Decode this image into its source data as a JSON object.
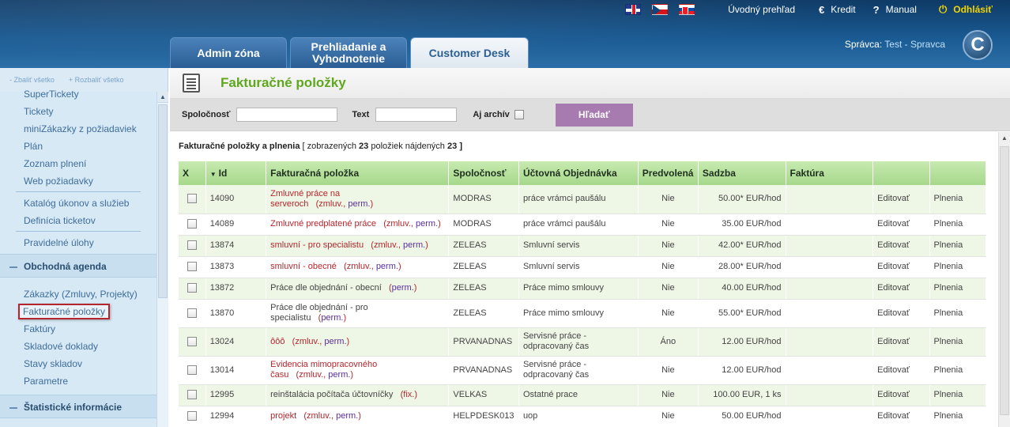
{
  "header": {
    "languages": [
      "English",
      "Czech",
      "Slovak"
    ],
    "links": {
      "overview": "Úvodný prehľad",
      "credit": "Kredit",
      "manual": "Manual",
      "logout": "Odhlásiť"
    },
    "tabs": [
      {
        "label_line1": "Admin zóna",
        "label_line2": ""
      },
      {
        "label_line1": "Prehliadanie a",
        "label_line2": "Vyhodnotenie"
      },
      {
        "label_line1": "Customer Desk",
        "label_line2": ""
      }
    ],
    "admin_prefix": "Správca:",
    "admin_name": "Test - Spravca",
    "logo_letter": "C"
  },
  "sidebar": {
    "collapse_all": "- Zbaliť všetko",
    "expand_all": "+ Rozbaliť všetko",
    "items_group1": [
      "SuperTickety",
      "Tickety",
      "miniZákazky z požiadaviek",
      "Plán",
      "Zoznam plnení",
      "Web požiadavky"
    ],
    "items_group2": [
      "Katalóg úkonov a služieb",
      "Definícia ticketov"
    ],
    "items_group3": [
      "Pravidelné úlohy"
    ],
    "section1": "Obchodná agenda",
    "items_group4": [
      "Zákazky (Zmluvy, Projekty)",
      "Fakturačné položky",
      "Faktúry",
      "Skladové doklady",
      "Stavy skladov",
      "Parametre"
    ],
    "section2": "Štatistické informácie"
  },
  "page": {
    "title": "Fakturačné položky",
    "filter": {
      "company_label": "Spoločnosť",
      "company_value": "",
      "text_label": "Text",
      "text_value": "",
      "archive_label": "Aj archív",
      "search_button": "Hľadať"
    },
    "summary": {
      "title": "Fakturačné položky a plnenia",
      "prefix": "[ zobrazených",
      "shown": "23",
      "middle": "položiek nájdených",
      "found": "23",
      "suffix": "]"
    },
    "table": {
      "columns": [
        "X",
        "Id",
        "Fakturačná položka",
        "Spoločnosť",
        "Účtovná Objednávka",
        "Predvolená",
        "Sadzba",
        "Faktúra",
        "",
        ""
      ],
      "rows": [
        {
          "id": "14090",
          "name_line1": "Zmluvné práce na",
          "name_line2": "serveroch",
          "tag": "(",
          "tag1": "zmluv.",
          "tag_sep": ", ",
          "tag2": "perm.",
          "tag_end": ")",
          "name_plain": false,
          "company": "MODRAS",
          "order_line1": "práce vrámci paušálu",
          "order_line2": "",
          "default": "Nie",
          "rate": "50.00* EUR/hod",
          "invoice": "",
          "edit": "Editovať",
          "fulfil": "Plnenia"
        },
        {
          "id": "14089",
          "name_line1": "Zmluvné predplatené práce",
          "name_line2": "",
          "tag": "(",
          "tag1": "zmluv.",
          "tag_sep": ", ",
          "tag2": "perm.",
          "tag_end": ")",
          "name_plain": false,
          "company": "MODRAS",
          "order_line1": "práce vrámci paušálu",
          "order_line2": "",
          "default": "Nie",
          "rate": "35.00 EUR/hod",
          "invoice": "",
          "edit": "Editovať",
          "fulfil": "Plnenia"
        },
        {
          "id": "13874",
          "name_line1": "smluvní - pro specialistu",
          "name_line2": "",
          "tag": "(",
          "tag1": "zmluv.",
          "tag_sep": ", ",
          "tag2": "perm.",
          "tag_end": ")",
          "name_plain": false,
          "company": "ZELEAS",
          "order_line1": "Smluvní servis",
          "order_line2": "",
          "default": "Nie",
          "rate": "42.00* EUR/hod",
          "invoice": "",
          "edit": "Editovať",
          "fulfil": "Plnenia"
        },
        {
          "id": "13873",
          "name_line1": "smluvní - obecné",
          "name_line2": "",
          "tag": "(",
          "tag1": "zmluv.",
          "tag_sep": ", ",
          "tag2": "perm.",
          "tag_end": ")",
          "name_plain": false,
          "company": "ZELEAS",
          "order_line1": "Smluvní servis",
          "order_line2": "",
          "default": "Nie",
          "rate": "28.00* EUR/hod",
          "invoice": "",
          "edit": "Editovať",
          "fulfil": "Plnenia"
        },
        {
          "id": "13872",
          "name_line1": "Práce dle objednání - obecní",
          "name_line2": "",
          "tag": "(",
          "tag1": "",
          "tag_sep": "",
          "tag2": "perm.",
          "tag_end": ")",
          "name_plain": true,
          "company": "ZELEAS",
          "order_line1": "Práce mimo smlouvy",
          "order_line2": "",
          "default": "Nie",
          "rate": "40.00 EUR/hod",
          "invoice": "",
          "edit": "Editovať",
          "fulfil": "Plnenia"
        },
        {
          "id": "13870",
          "name_line1": "Práce dle objednání - pro",
          "name_line2": "specialistu",
          "tag": "(",
          "tag1": "",
          "tag_sep": "",
          "tag2": "perm.",
          "tag_end": ")",
          "name_plain": true,
          "company": "ZELEAS",
          "order_line1": "Práce mimo smlouvy",
          "order_line2": "",
          "default": "Nie",
          "rate": "55.00* EUR/hod",
          "invoice": "",
          "edit": "Editovať",
          "fulfil": "Plnenia"
        },
        {
          "id": "13024",
          "name_line1": "ôôô",
          "name_line2": "",
          "tag": "(",
          "tag1": "zmluv.",
          "tag_sep": ", ",
          "tag2": "perm.",
          "tag_end": ")",
          "name_plain": false,
          "company": "PRVANADNAS",
          "order_line1": "Servisné práce -",
          "order_line2": "odpracovaný čas",
          "default": "Áno",
          "rate": "12.00 EUR/hod",
          "invoice": "",
          "edit": "Editovať",
          "fulfil": "Plnenia"
        },
        {
          "id": "13014",
          "name_line1": "Evidencia mimopracovného",
          "name_line2": "času",
          "tag": "(",
          "tag1": "zmluv.",
          "tag_sep": ", ",
          "tag2": "perm.",
          "tag_end": ")",
          "name_plain": false,
          "company": "PRVANADNAS",
          "order_line1": "Servisné práce -",
          "order_line2": "odpracovaný čas",
          "default": "Nie",
          "rate": "12.00 EUR/hod",
          "invoice": "",
          "edit": "Editovať",
          "fulfil": "Plnenia"
        },
        {
          "id": "12995",
          "name_line1": "reinštalácia počítača účtovníčky",
          "name_line2": "",
          "tag": "(",
          "tag1": "fix.",
          "tag_sep": "",
          "tag2": "",
          "tag_end": ")",
          "name_plain": true,
          "company": "VELKAS",
          "order_line1": "Ostatné prace",
          "order_line2": "",
          "default": "Nie",
          "rate": "100.00 EUR, 1 ks",
          "invoice": "",
          "edit": "Editovať",
          "fulfil": "Plnenia"
        },
        {
          "id": "12994",
          "name_line1": "projekt",
          "name_line2": "",
          "tag": "(",
          "tag1": "zmluv.",
          "tag_sep": ", ",
          "tag2": "perm.",
          "tag_end": ")",
          "name_plain": false,
          "company": "HELPDESK013",
          "order_line1": "uop",
          "order_line2": "",
          "default": "Nie",
          "rate": "50.00 EUR/hod",
          "invoice": "",
          "edit": "Editovať",
          "fulfil": "Plnenia"
        }
      ]
    }
  },
  "colors": {
    "header_blue": "#1a5a92",
    "title_green": "#5fa81e",
    "search_button": "#a77ab0",
    "table_header_green": "#a6d88a",
    "item_red": "#b3262d",
    "perm_purple": "#5a2ea0"
  }
}
